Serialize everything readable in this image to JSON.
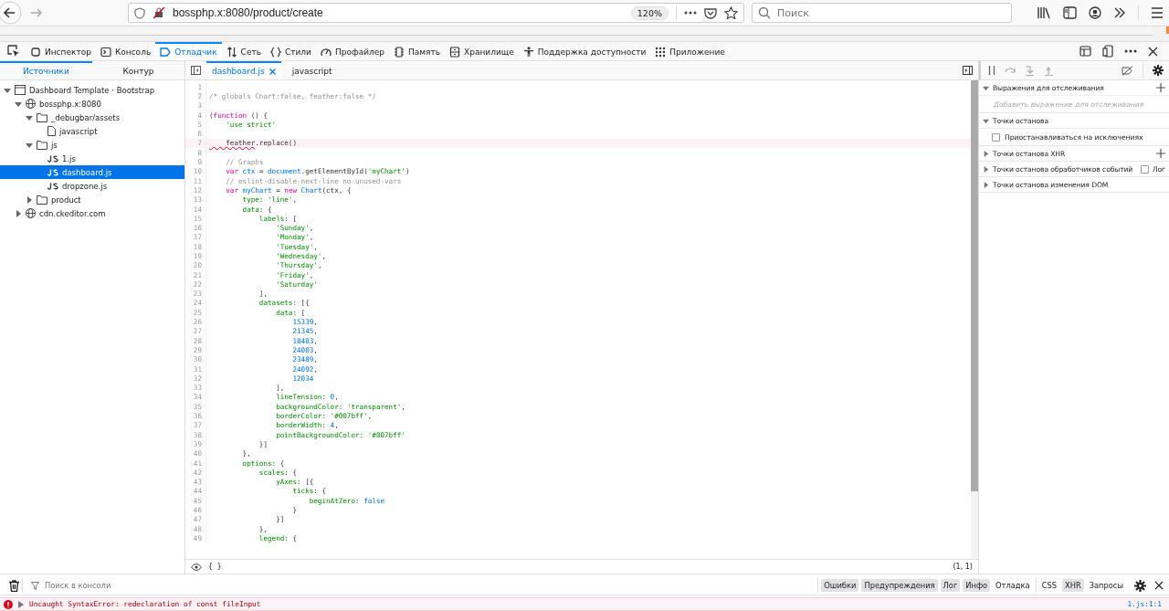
{
  "browser": {
    "url": "bossphp.x:8080/product/create",
    "zoom": "120%",
    "search": {
      "placeholder": "Поиск"
    }
  },
  "devtools": {
    "tabs": [
      {
        "label": "Инспектор",
        "selected": false
      },
      {
        "label": "Консоль",
        "selected": false
      },
      {
        "label": "Отладчик",
        "selected": true
      },
      {
        "label": "Сеть",
        "selected": false
      },
      {
        "label": "Стили",
        "selected": false
      },
      {
        "label": "Профайлер",
        "selected": false
      },
      {
        "label": "Память",
        "selected": false
      },
      {
        "label": "Хранилище",
        "selected": false
      },
      {
        "label": "Поддержка доступности",
        "selected": false
      },
      {
        "label": "Приложение",
        "selected": false
      }
    ]
  },
  "sources": {
    "tabs": [
      {
        "label": "Источники",
        "selected": true
      },
      {
        "label": "Контур",
        "selected": false
      }
    ],
    "tree": [
      {
        "label": "Dashboard Template · Bootstrap",
        "kind": "page",
        "expanded": true,
        "selected": false,
        "children": [
          {
            "label": "bossphp.x:8080",
            "kind": "domain",
            "expanded": true,
            "selected": false,
            "children": [
              {
                "label": "_debugbar/assets",
                "kind": "folder",
                "expanded": true,
                "selected": false,
                "children": [
                  {
                    "label": "javascript",
                    "kind": "file",
                    "selected": false
                  }
                ]
              },
              {
                "label": "js",
                "kind": "folder",
                "expanded": true,
                "selected": false,
                "children": [
                  {
                    "label": "1.js",
                    "kind": "js",
                    "selected": false
                  },
                  {
                    "label": "dashboard.js",
                    "kind": "js",
                    "selected": true
                  },
                  {
                    "label": "dropzone.js",
                    "kind": "js",
                    "selected": false
                  }
                ]
              },
              {
                "label": "product",
                "kind": "folder",
                "expanded": false,
                "selected": false
              }
            ]
          },
          {
            "label": "cdn.ckeditor.com",
            "kind": "domain",
            "expanded": false,
            "selected": false
          }
        ]
      }
    ]
  },
  "editor": {
    "tabs": [
      {
        "label": "dashboard.js",
        "selected": true,
        "closable": true
      },
      {
        "label": "javascript",
        "selected": false,
        "closable": false
      }
    ],
    "lines": [
      {
        "no": "1"
      },
      {
        "no": "2",
        "tokens": [
          {
            "kind": "comment",
            "text": "/* globals Chart:false, feather:false */"
          }
        ]
      },
      {
        "no": "3"
      },
      {
        "no": "4",
        "tokens": [
          {
            "kind": "plain",
            "text": "("
          },
          {
            "kind": "keyword",
            "text": "function"
          },
          {
            "kind": "plain",
            "text": " () {"
          }
        ]
      },
      {
        "no": "5",
        "tokens": [
          {
            "kind": "string",
            "text": "    'use strict'"
          }
        ]
      },
      {
        "no": "6"
      },
      {
        "no": "7",
        "highlighted": true,
        "tokens": [
          {
            "kind": "error",
            "text": "    feather"
          },
          {
            "kind": "plain",
            "text": ".replace()"
          }
        ]
      },
      {
        "no": "8"
      },
      {
        "no": "9",
        "tokens": [
          {
            "kind": "comment",
            "text": "    // Graphs"
          }
        ]
      },
      {
        "no": "10",
        "tokens": [
          {
            "kind": "keyword",
            "text": "    var"
          },
          {
            "kind": "identifier",
            "text": " ctx"
          },
          {
            "kind": "plain",
            "text": " = "
          },
          {
            "kind": "identifier",
            "text": "document"
          },
          {
            "kind": "plain",
            "text": ".getElementById("
          },
          {
            "kind": "string",
            "text": "'myChart'"
          },
          {
            "kind": "plain",
            "text": ")"
          }
        ]
      },
      {
        "no": "11",
        "tokens": [
          {
            "kind": "comment",
            "text": "    // eslint-disable-next-line no-unused-vars"
          }
        ]
      },
      {
        "no": "12",
        "tokens": [
          {
            "kind": "keyword",
            "text": "    var"
          },
          {
            "kind": "identifier",
            "text": " myChart"
          },
          {
            "kind": "plain",
            "text": " = "
          },
          {
            "kind": "keyword",
            "text": "new"
          },
          {
            "kind": "identifier",
            "text": " Chart"
          },
          {
            "kind": "plain",
            "text": "(ctx, {"
          }
        ]
      },
      {
        "no": "13",
        "tokens": [
          {
            "kind": "property",
            "text": "        type:"
          },
          {
            "kind": "string",
            "text": " 'line'"
          },
          {
            "kind": "plain",
            "text": ","
          }
        ]
      },
      {
        "no": "14",
        "tokens": [
          {
            "kind": "property",
            "text": "        data:"
          },
          {
            "kind": "plain",
            "text": " {"
          }
        ]
      },
      {
        "no": "15",
        "tokens": [
          {
            "kind": "property",
            "text": "            labels:"
          },
          {
            "kind": "plain",
            "text": " ["
          }
        ]
      },
      {
        "no": "16",
        "tokens": [
          {
            "kind": "string",
            "text": "                'Sunday'"
          },
          {
            "kind": "plain",
            "text": ","
          }
        ]
      },
      {
        "no": "17",
        "tokens": [
          {
            "kind": "string",
            "text": "                'Monday'"
          },
          {
            "kind": "plain",
            "text": ","
          }
        ]
      },
      {
        "no": "18",
        "tokens": [
          {
            "kind": "string",
            "text": "                'Tuesday'"
          },
          {
            "kind": "plain",
            "text": ","
          }
        ]
      },
      {
        "no": "19",
        "tokens": [
          {
            "kind": "string",
            "text": "                'Wednesday'"
          },
          {
            "kind": "plain",
            "text": ","
          }
        ]
      },
      {
        "no": "20",
        "tokens": [
          {
            "kind": "string",
            "text": "                'Thursday'"
          },
          {
            "kind": "plain",
            "text": ","
          }
        ]
      },
      {
        "no": "21",
        "tokens": [
          {
            "kind": "string",
            "text": "                'Friday'"
          },
          {
            "kind": "plain",
            "text": ","
          }
        ]
      },
      {
        "no": "22",
        "tokens": [
          {
            "kind": "string",
            "text": "                'Saturday'"
          }
        ]
      },
      {
        "no": "23",
        "tokens": [
          {
            "kind": "plain",
            "text": "            ],"
          }
        ]
      },
      {
        "no": "24",
        "tokens": [
          {
            "kind": "property",
            "text": "            datasets:"
          },
          {
            "kind": "plain",
            "text": " [{"
          }
        ]
      },
      {
        "no": "25",
        "tokens": [
          {
            "kind": "property",
            "text": "                data:"
          },
          {
            "kind": "plain",
            "text": " ["
          }
        ]
      },
      {
        "no": "26",
        "tokens": [
          {
            "kind": "number",
            "text": "                    15339"
          },
          {
            "kind": "plain",
            "text": ","
          }
        ]
      },
      {
        "no": "27",
        "tokens": [
          {
            "kind": "number",
            "text": "                    21345"
          },
          {
            "kind": "plain",
            "text": ","
          }
        ]
      },
      {
        "no": "28",
        "tokens": [
          {
            "kind": "number",
            "text": "                    18483"
          },
          {
            "kind": "plain",
            "text": ","
          }
        ]
      },
      {
        "no": "29",
        "tokens": [
          {
            "kind": "number",
            "text": "                    24003"
          },
          {
            "kind": "plain",
            "text": ","
          }
        ]
      },
      {
        "no": "30",
        "tokens": [
          {
            "kind": "number",
            "text": "                    23489"
          },
          {
            "kind": "plain",
            "text": ","
          }
        ]
      },
      {
        "no": "31",
        "tokens": [
          {
            "kind": "number",
            "text": "                    24092"
          },
          {
            "kind": "plain",
            "text": ","
          }
        ]
      },
      {
        "no": "32",
        "tokens": [
          {
            "kind": "number",
            "text": "                    12034"
          }
        ]
      },
      {
        "no": "33",
        "tokens": [
          {
            "kind": "plain",
            "text": "                ],"
          }
        ]
      },
      {
        "no": "34",
        "tokens": [
          {
            "kind": "property",
            "text": "                lineTension:"
          },
          {
            "kind": "number",
            "text": " 0"
          },
          {
            "kind": "plain",
            "text": ","
          }
        ]
      },
      {
        "no": "35",
        "tokens": [
          {
            "kind": "property",
            "text": "                backgroundColor:"
          },
          {
            "kind": "string",
            "text": " 'transparent'"
          },
          {
            "kind": "plain",
            "text": ","
          }
        ]
      },
      {
        "no": "36",
        "tokens": [
          {
            "kind": "property",
            "text": "                borderColor:"
          },
          {
            "kind": "string",
            "text": " '#007bff'"
          },
          {
            "kind": "plain",
            "text": ","
          }
        ]
      },
      {
        "no": "37",
        "tokens": [
          {
            "kind": "property",
            "text": "                borderWidth:"
          },
          {
            "kind": "number",
            "text": " 4"
          },
          {
            "kind": "plain",
            "text": ","
          }
        ]
      },
      {
        "no": "38",
        "tokens": [
          {
            "kind": "property",
            "text": "                pointBackgroundColor:"
          },
          {
            "kind": "string",
            "text": " '#007bff'"
          }
        ]
      },
      {
        "no": "39",
        "tokens": [
          {
            "kind": "plain",
            "text": "            }]"
          }
        ]
      },
      {
        "no": "40",
        "tokens": [
          {
            "kind": "plain",
            "text": "        },"
          }
        ]
      },
      {
        "no": "41",
        "tokens": [
          {
            "kind": "property",
            "text": "        options:"
          },
          {
            "kind": "plain",
            "text": " {"
          }
        ]
      },
      {
        "no": "42",
        "tokens": [
          {
            "kind": "property",
            "text": "            scales:"
          },
          {
            "kind": "plain",
            "text": " {"
          }
        ]
      },
      {
        "no": "43",
        "tokens": [
          {
            "kind": "property",
            "text": "                yAxes:"
          },
          {
            "kind": "plain",
            "text": " [{"
          }
        ]
      },
      {
        "no": "44",
        "tokens": [
          {
            "kind": "property",
            "text": "                    ticks:"
          },
          {
            "kind": "plain",
            "text": " {"
          }
        ]
      },
      {
        "no": "45",
        "tokens": [
          {
            "kind": "property",
            "text": "                        beginAtZero:"
          },
          {
            "kind": "number",
            "text": " false"
          }
        ]
      },
      {
        "no": "46",
        "tokens": [
          {
            "kind": "plain",
            "text": "                    }"
          }
        ]
      },
      {
        "no": "47",
        "tokens": [
          {
            "kind": "plain",
            "text": "                }]"
          }
        ]
      },
      {
        "no": "48",
        "tokens": [
          {
            "kind": "plain",
            "text": "            },"
          }
        ]
      },
      {
        "no": "49",
        "tokens": [
          {
            "kind": "property",
            "text": "            legend:"
          },
          {
            "kind": "plain",
            "text": " {"
          }
        ]
      }
    ],
    "footer": {
      "braces": "{ }",
      "position": "(1, 1)"
    }
  },
  "debugger": {
    "sections": [
      {
        "title": "Выражения для отслеживания",
        "expanded": true,
        "addable": true,
        "placeholder": "Добавить выражение для отслеживания"
      },
      {
        "title": "Точки останова",
        "expanded": true,
        "addable": false,
        "checkbox": {
          "label": "Приостанавливаться на исключениях",
          "checked": false
        }
      },
      {
        "title": "Точки останова XHR",
        "expanded": false,
        "addable": true
      },
      {
        "title": "Точки останова обработчиков событий",
        "expanded": false,
        "addable": false,
        "toggle": {
          "label": "Лог",
          "checked": false
        }
      },
      {
        "title": "Точки останова изменения DOM",
        "expanded": false,
        "addable": false
      }
    ]
  },
  "console": {
    "filter": {
      "placeholder": "Поиск в консоли"
    },
    "levels": [
      {
        "label": "Ошибки",
        "selected": true
      },
      {
        "label": "Предупреждения",
        "selected": true
      },
      {
        "label": "Лог",
        "selected": true
      },
      {
        "label": "Инфо",
        "selected": true
      },
      {
        "label": "Отладка",
        "selected": false
      }
    ],
    "types": [
      {
        "label": "CSS",
        "selected": false
      },
      {
        "label": "XHR",
        "selected": true
      },
      {
        "label": "Запросы",
        "selected": false
      }
    ],
    "messages": [
      {
        "kind": "error",
        "text": "Uncaught SyntaxError: redeclaration of const fileInput",
        "source": "1.js:1:1"
      }
    ]
  }
}
